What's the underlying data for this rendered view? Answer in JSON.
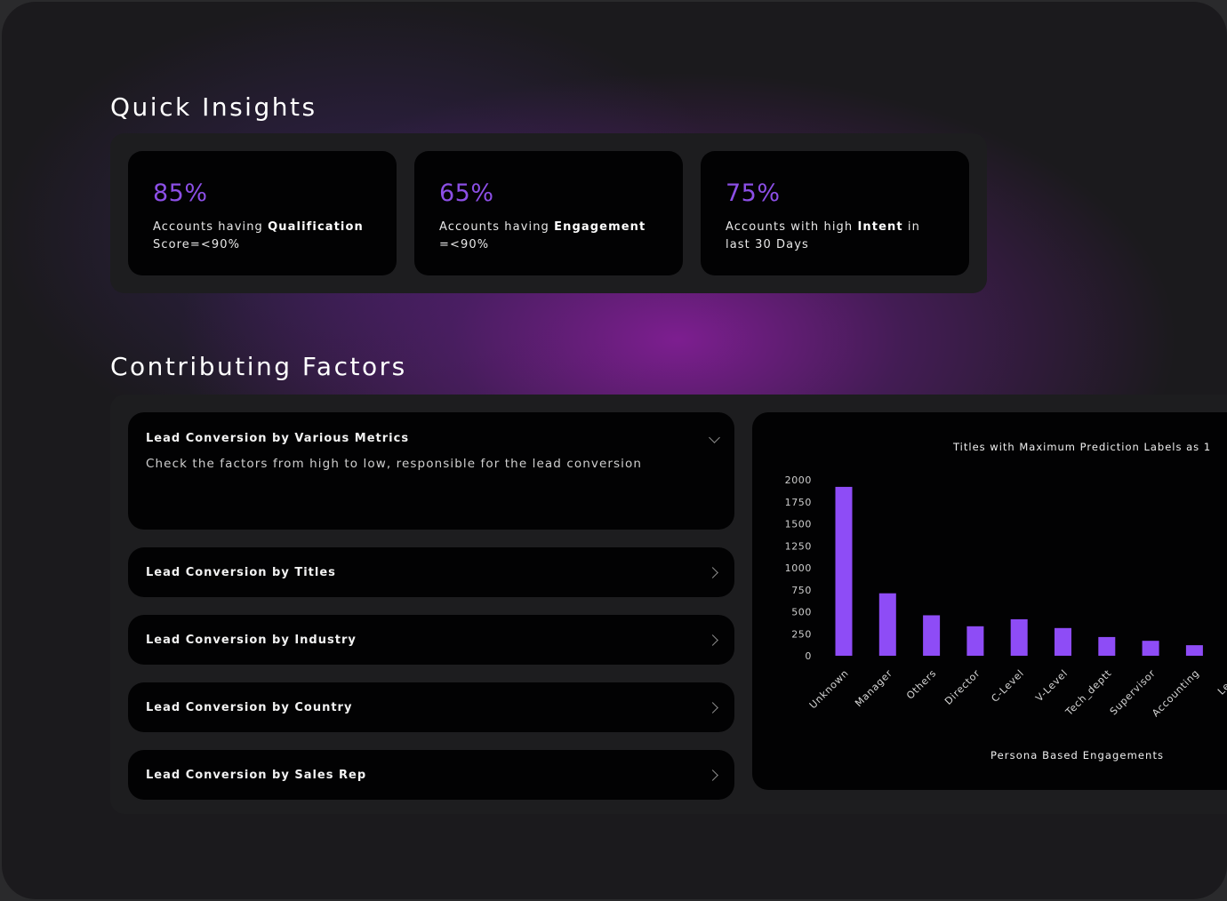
{
  "quick_insights": {
    "title": "Quick Insights",
    "cards": [
      {
        "value": "85%",
        "desc_pre": "Accounts having ",
        "desc_bold": "Qualification",
        "desc_post": " Score=<90%"
      },
      {
        "value": "65%",
        "desc_pre": "Accounts having ",
        "desc_bold": "Engagement",
        "desc_post": " =<90%"
      },
      {
        "value": "75%",
        "desc_pre": "Accounts with high ",
        "desc_bold": "Intent",
        "desc_post": " in last 30 Days"
      }
    ]
  },
  "contributing_factors": {
    "title": "Contributing Factors",
    "expanded": {
      "title": "Lead Conversion by Various Metrics",
      "description": "Check the factors from high to low, responsible for the lead conversion",
      "icon": "chevron-down-icon"
    },
    "items": [
      {
        "title": "Lead Conversion by Titles",
        "icon": "chevron-right-icon"
      },
      {
        "title": "Lead Conversion by Industry",
        "icon": "chevron-right-icon"
      },
      {
        "title": "Lead Conversion by Country",
        "icon": "chevron-right-icon"
      },
      {
        "title": "Lead Conversion by Sales Rep",
        "icon": "chevron-right-icon"
      }
    ]
  },
  "colors": {
    "accent": "#8c4fe6",
    "bar": "#8e4cf6"
  },
  "chart_data": {
    "type": "bar",
    "title": "Titles with Maximum Prediction Labels as 1",
    "xlabel": "Persona Based Engagements",
    "ylabel": "",
    "ylim": [
      0,
      2000
    ],
    "yticks": [
      0,
      250,
      500,
      750,
      1000,
      1250,
      1500,
      1750,
      2000
    ],
    "categories": [
      "Unknown",
      "Manager",
      "Others",
      "Director",
      "C-Level",
      "V-Level",
      "Tech_deptt",
      "Supervisor",
      "Accounting",
      "Lea..."
    ],
    "values": [
      1920,
      710,
      460,
      335,
      415,
      315,
      213,
      170,
      120,
      null
    ],
    "grid": false,
    "legend": "none"
  }
}
